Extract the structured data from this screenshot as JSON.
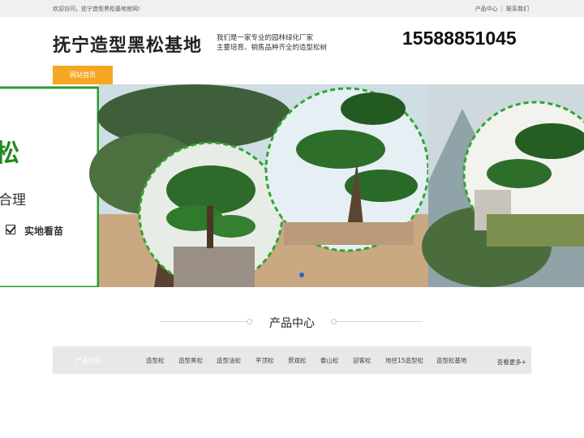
{
  "topbar": {
    "welcome": "欢迎访问，抚宁造型黑松基地官网!",
    "link_products": "产品中心",
    "link_contact": "联系我们"
  },
  "header": {
    "site_title": "抚宁造型黑松基地",
    "slogan_line1": "我们是一家专业的园林绿化厂家",
    "slogan_line2": "主要培育、销售品种齐全的造型松树",
    "phone": "15588851045"
  },
  "nav": {
    "home": "网站首页"
  },
  "banner": {
    "text_large": "松",
    "text_mid": "合理",
    "text_check": "实地看苗"
  },
  "products": {
    "heading": "产品中心",
    "category_title": "产品栏目",
    "categories": [
      "造型松",
      "造型黑松",
      "造型油松",
      "平顶松",
      "景观松",
      "泰山松",
      "迎客松",
      "地径15造型松",
      "造型松基地"
    ],
    "more": "查看更多+"
  },
  "colors": {
    "accent_orange": "#f5a623",
    "brand_green": "#1f8a1f"
  }
}
